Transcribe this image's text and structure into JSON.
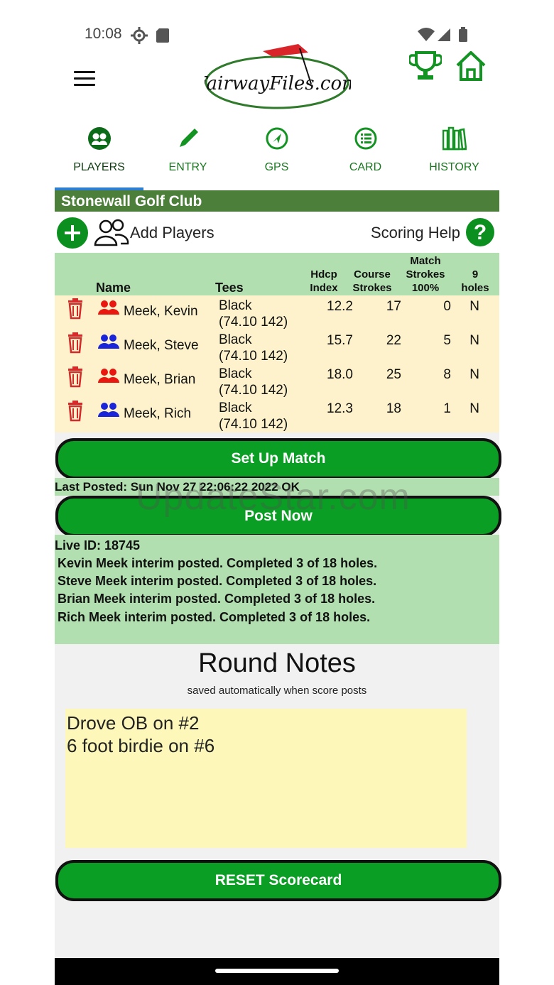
{
  "status": {
    "time": "10:08"
  },
  "logo": {
    "text": "FairwayFiles.com"
  },
  "tabs": [
    {
      "label": "PLAYERS",
      "icon": "players-icon",
      "active": true
    },
    {
      "label": "ENTRY",
      "icon": "pencil-icon"
    },
    {
      "label": "GPS",
      "icon": "navigation-icon"
    },
    {
      "label": "CARD",
      "icon": "list-icon"
    },
    {
      "label": "HISTORY",
      "icon": "books-icon"
    }
  ],
  "club": {
    "name": "Stonewall Golf Club"
  },
  "toolbar": {
    "add_players": "Add Players",
    "scoring_help": "Scoring Help",
    "help_symbol": "?"
  },
  "table": {
    "headers": {
      "name": "Name",
      "tees": "Tees",
      "hdcp_1": "Hdcp",
      "hdcp_2": "Index",
      "course_1": "Course",
      "course_2": "Strokes",
      "match_1": "Match",
      "match_2": "Strokes",
      "match_3": "100%",
      "nine_1": "9",
      "nine_2": "holes"
    },
    "rows": [
      {
        "name": "Meek, Kevin",
        "tee_1": "Black",
        "tee_2": "(74.10 142)",
        "hdcp": "12.2",
        "course": "17",
        "match": "0",
        "nine": "N",
        "color": "#e8170f"
      },
      {
        "name": "Meek, Steve",
        "tee_1": "Black",
        "tee_2": "(74.10 142)",
        "hdcp": "15.7",
        "course": "22",
        "match": "5",
        "nine": "N",
        "color": "#1a24d8"
      },
      {
        "name": "Meek, Brian",
        "tee_1": "Black",
        "tee_2": "(74.10 142)",
        "hdcp": "18.0",
        "course": "25",
        "match": "8",
        "nine": "N",
        "color": "#e8170f"
      },
      {
        "name": "Meek, Rich",
        "tee_1": "Black",
        "tee_2": "(74.10 142)",
        "hdcp": "12.3",
        "course": "18",
        "match": "1",
        "nine": "N",
        "color": "#1a24d8"
      }
    ]
  },
  "buttons": {
    "setup_match": "Set Up Match",
    "post_now": "Post Now",
    "reset": "RESET Scorecard"
  },
  "last_posted": "Last Posted: Sun Nov 27 22:06:22 2022 OK",
  "live": {
    "id": "Live ID: 18745",
    "lines": [
      "Kevin Meek interim posted. Completed 3 of 18 holes.",
      "Steve Meek interim posted. Completed 3 of 18 holes.",
      "Brian Meek interim posted. Completed 3 of 18 holes.",
      "Rich Meek interim posted. Completed 3 of 18 holes."
    ]
  },
  "notes": {
    "title": "Round Notes",
    "subtitle": "saved automatically when score posts",
    "line_1": "Drove OB on #2",
    "line_2": "6 foot birdie on #6"
  },
  "watermark": "UpdateStar.com",
  "colors": {
    "green": "#0a9e24",
    "header_green": "#4c7f3a",
    "light_green": "#b2dfb0",
    "cream": "#fdf2cc",
    "notes_yellow": "#fdf8b9"
  }
}
